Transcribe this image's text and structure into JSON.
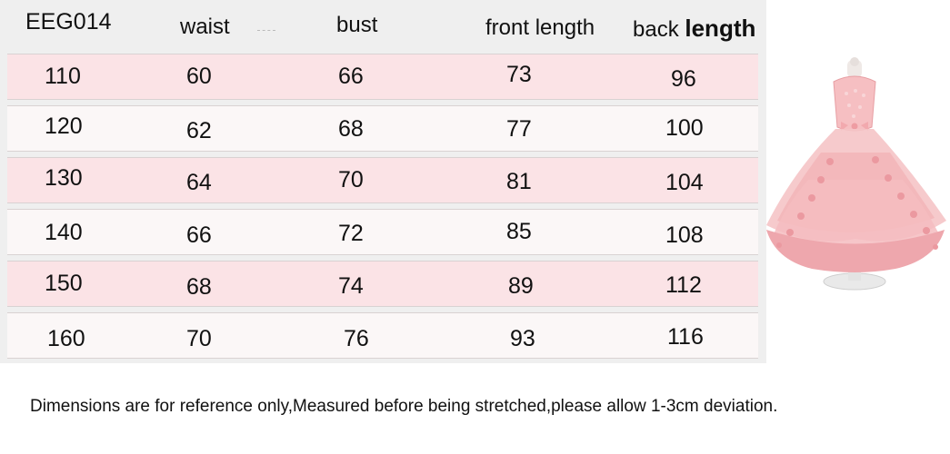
{
  "table": {
    "model": "EEG014",
    "headers": {
      "waist": "waist",
      "bust": "bust",
      "front": "front  length",
      "back_prefix": "back",
      "back_suffix": "length"
    },
    "rows": [
      {
        "size": "110",
        "waist": "60",
        "bust": "66",
        "front": "73",
        "back": "96"
      },
      {
        "size": "120",
        "waist": "62",
        "bust": "68",
        "front": "77",
        "back": "100"
      },
      {
        "size": "130",
        "waist": "64",
        "bust": "70",
        "front": "81",
        "back": "104"
      },
      {
        "size": "140",
        "waist": "66",
        "bust": "72",
        "front": "85",
        "back": "108"
      },
      {
        "size": "150",
        "waist": "68",
        "bust": "74",
        "front": "89",
        "back": "112"
      },
      {
        "size": "160",
        "waist": "70",
        "bust": "76",
        "front": "93",
        "back": "116"
      }
    ]
  },
  "note": "Dimensions are for reference only,Measured before being stretched,please allow 1-3cm deviation.",
  "colors": {
    "row_pink": "#fbe3e6",
    "row_white": "#fbf7f7",
    "dress": "#f3b3b6"
  },
  "image": {
    "icon": "pink-dress-icon"
  }
}
